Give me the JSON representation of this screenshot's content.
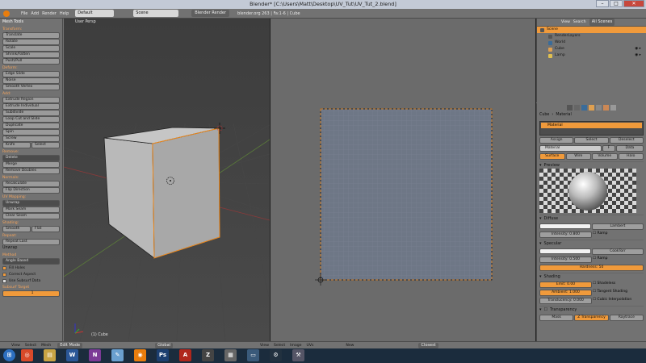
{
  "window": {
    "title": "Blender* [C:\\Users\\Matt\\Desktop\\UV_Tut\\UV_Tut_2.blend]"
  },
  "infobar": {
    "menus": [
      "File",
      "Add",
      "Render",
      "Help"
    ],
    "layout": "Default",
    "scene": "Scene",
    "engine": "Blender Render",
    "stats": "blender.org 263 | Fa:1-6 | Cube"
  },
  "toolshelf": {
    "title": "Mesh Tools",
    "transform": {
      "label": "Transform:",
      "buttons": [
        "Translate",
        "Rotate",
        "Scale",
        "Shrink/Fatten",
        "Push/Pull"
      ]
    },
    "deform": {
      "label": "Deform:",
      "buttons": [
        "Edge Slide",
        "Noise",
        "Smooth Vertex"
      ]
    },
    "add": {
      "label": "Add:",
      "buttons": [
        "Extrude Region",
        "Extrude Individual",
        "Subdivide",
        "Loop Cut and Slide",
        "Duplicate",
        "Spin",
        "Screw"
      ],
      "knife": "Knife",
      "select": "Select"
    },
    "remove": {
      "label": "Remove:",
      "buttons": [
        "Delete",
        "Merge",
        "Remove Doubles"
      ]
    },
    "normals": {
      "label": "Normals:",
      "buttons": [
        "Recalculate",
        "Flip Direction"
      ]
    },
    "uvmapping": {
      "label": "UV Mapping:",
      "buttons": [
        "Unwrap",
        "Mark Seam",
        "Clear Seam"
      ]
    },
    "shading": {
      "label": "Shading:",
      "smooth": "Smooth",
      "flat": "Flat"
    },
    "repeat": {
      "label": "Repeat:",
      "buttons": [
        "Repeat Last"
      ]
    },
    "operator": {
      "title": "Unwrap",
      "method_label": "Method",
      "method_value": "Angle Based",
      "fill_holes": "Fill Holes",
      "correct_aspect": "Correct Aspect",
      "use_subsurf": "Use Subsurf Data",
      "subsurf_label": "Subsurf Target",
      "subsurf_value": "1"
    }
  },
  "viewport": {
    "label": "User Persp",
    "object": "(1) Cube"
  },
  "outliner": {
    "header": [
      "View",
      "Search",
      "All Scenes"
    ],
    "items": [
      "Scene",
      "RenderLayers",
      "World",
      "Cube",
      "Lamp"
    ]
  },
  "properties": {
    "context": [
      "Cube",
      "Material"
    ],
    "slot": "Material",
    "buttons": [
      "Assign",
      "Select",
      "Deselect"
    ],
    "material_name": "Material",
    "material_users": "F",
    "data_label": "Data",
    "tabs": [
      "Surface",
      "Wire",
      "Volume",
      "Halo"
    ],
    "preview_label": "Preview",
    "diffuse": {
      "label": "Diffuse",
      "shader": "Lambert",
      "intensity": "Intensity: 0.800",
      "ramp": "Ramp"
    },
    "specular": {
      "label": "Specular",
      "shader": "CookTorr",
      "intensity": "Intensity: 0.500",
      "ramp": "Ramp",
      "hardness": "Hardness: 50"
    },
    "shading": {
      "label": "Shading",
      "emit": "Emit: 0.00",
      "ambient": "Ambient: 1.000",
      "translucency": "Translucency: 0.000",
      "shadeless": "Shadeless",
      "tangent": "Tangent Shading",
      "cubic": "Cubic Interpolation"
    },
    "transparency": {
      "label": "Transparency",
      "modes": [
        "Mask",
        "Z Transparency",
        "Raytrace"
      ]
    }
  },
  "header3d": {
    "menus": [
      "View",
      "Select",
      "Mesh"
    ],
    "mode": "Edit Mode",
    "pivot": "Global"
  },
  "headeruv": {
    "menus": [
      "View",
      "Select",
      "Image",
      "UVs"
    ],
    "new": "New",
    "sticky": "Closest"
  },
  "taskbar": {
    "apps": [
      "Chrome",
      "Explorer",
      "Word",
      "OneNote",
      "Paint",
      "Blender",
      "Photoshop",
      "Acrobat",
      "ZBrush",
      "Calculator",
      "Keynote",
      "Steam",
      "Settings"
    ]
  }
}
